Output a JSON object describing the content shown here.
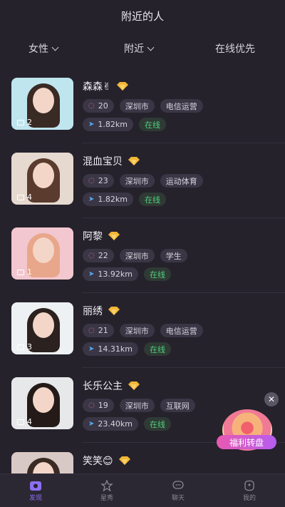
{
  "header": {
    "title": "附近的人"
  },
  "filters": {
    "gender": "女性",
    "distance": "附近",
    "sort": "在线优先"
  },
  "users": [
    {
      "name": "森森✌",
      "photos": "2",
      "messages": "20",
      "city": "深圳市",
      "job": "电信运营",
      "distance": "1.82km",
      "status": "在线",
      "photo_bg": "#bfe6ef"
    },
    {
      "name": "混血宝贝",
      "photos": "4",
      "messages": "23",
      "city": "深圳市",
      "job": "运动体育",
      "distance": "1.82km",
      "status": "在线",
      "photo_bg": "#e6d9cf"
    },
    {
      "name": "阿黎",
      "photos": "1",
      "messages": "22",
      "city": "深圳市",
      "job": "学生",
      "distance": "13.92km",
      "status": "在线",
      "photo_bg": "#f2c7cf"
    },
    {
      "name": "丽绣",
      "photos": "3",
      "messages": "21",
      "city": "深圳市",
      "job": "电信运营",
      "distance": "14.31km",
      "status": "在线",
      "photo_bg": "#eef1f4"
    },
    {
      "name": "长乐公主",
      "photos": "4",
      "messages": "19",
      "city": "深圳市",
      "job": "互联网",
      "distance": "23.40km",
      "status": "在线",
      "photo_bg": "#e7e8ea"
    },
    {
      "name": "笑笑😊",
      "photos": "",
      "messages": "",
      "city": "",
      "job": "",
      "distance": "",
      "status": "",
      "photo_bg": "#d9c9c6"
    }
  ],
  "promo": {
    "label": "福利转盘"
  },
  "tabs": [
    {
      "label": "发现",
      "icon": "discover-icon"
    },
    {
      "label": "星秀",
      "icon": "star-icon"
    },
    {
      "label": "聊天",
      "icon": "chat-icon"
    },
    {
      "label": "我的",
      "icon": "profile-icon"
    }
  ],
  "colors": {
    "accent": "#8c6ff0",
    "online": "#4fcf7e",
    "background": "#25222c"
  }
}
